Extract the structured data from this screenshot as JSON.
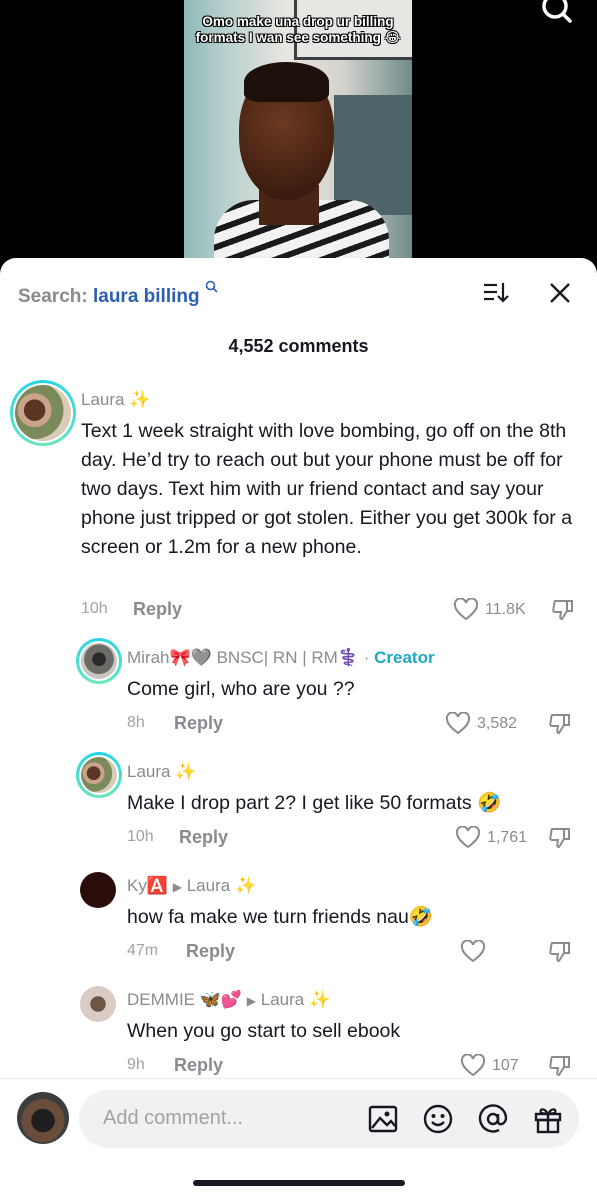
{
  "video": {
    "caption": "Omo make una drop ur billing formats I wan see something 😂"
  },
  "sheet": {
    "search_label": "Search:",
    "search_term": "laura billing",
    "comment_count": "4,552 comments"
  },
  "comments": [
    {
      "name": "Laura",
      "sparkle": "✨",
      "text": "Text 1 week straight with love bombing, go off on the 8th day. He’d try to reach out but your phone must be off for two days. Text him with ur friend contact and say your phone just tripped or got stolen. Either you get 300k for a screen or 1.2m for a new phone.",
      "time": "10h",
      "reply": "Reply",
      "likes": "11.8K"
    },
    {
      "name": "Mirah🎀🩶 BNSC| RN | RM⚕️",
      "creator_sep": "·",
      "creator": "Creator",
      "text": "Come girl, who are you ??",
      "time": "8h",
      "reply": "Reply",
      "likes": "3,582"
    },
    {
      "name": "Laura",
      "sparkle": "✨",
      "text": "Make I drop part 2? I get like 50 formats 🤣",
      "time": "10h",
      "reply": "Reply",
      "likes": "1,761"
    },
    {
      "name": "Ky🅰️",
      "reply_to": "Laura",
      "sparkle": "✨",
      "text": "how fa make we turn friends nau🤣",
      "time": "47m",
      "reply": "Reply",
      "likes": ""
    },
    {
      "name": "DEMMIE 🦋💕",
      "reply_to": "Laura",
      "sparkle": "✨",
      "text": "When you go start to sell ebook",
      "time": "9h",
      "reply": "Reply",
      "likes": "107"
    }
  ],
  "composer": {
    "placeholder": "Add comment..."
  },
  "icons": {
    "search": "search-icon",
    "sort": "sort-icon",
    "close": "close-icon",
    "heart": "heart-icon",
    "dislike": "dislike-icon",
    "image": "image-icon",
    "emoji": "emoji-icon",
    "mention": "mention-icon",
    "gift": "gift-icon"
  },
  "colors": {
    "search_term": "#2b5fb4",
    "creator": "#20a7c8",
    "sparkle": "#f5c542"
  }
}
